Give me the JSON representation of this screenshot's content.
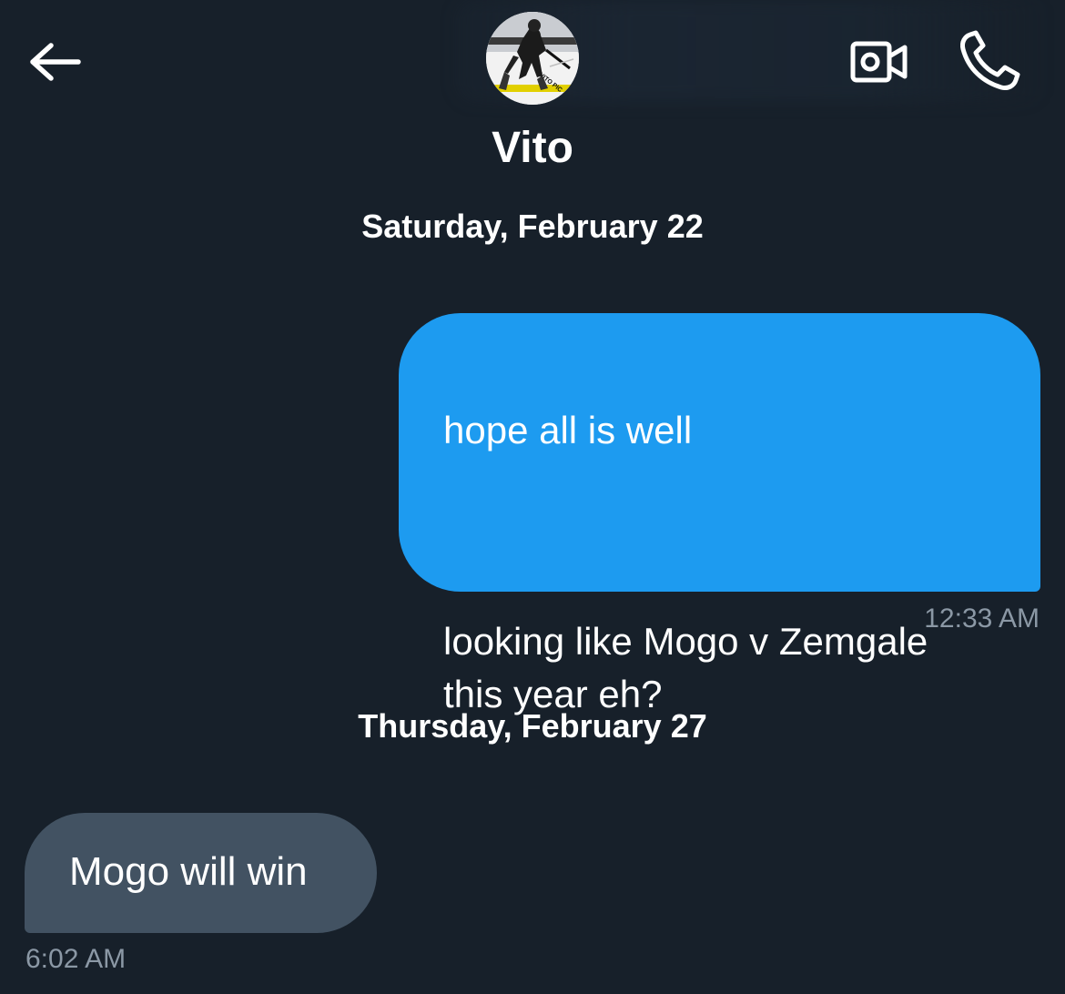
{
  "header": {
    "contact_name": "Vito",
    "avatar_caption": "VITO PIC",
    "back_icon": "arrow-left-icon",
    "video_icon": "video-camera-icon",
    "call_icon": "phone-icon"
  },
  "conversation": {
    "groups": [
      {
        "date": "Saturday, February 22",
        "messages": [
          {
            "direction": "sent",
            "paragraphs": [
              "hope all is well",
              "looking like Mogo v Zemgale\nthis year eh?"
            ],
            "time": "12:33 AM"
          }
        ]
      },
      {
        "date": "Thursday, February 27",
        "messages": [
          {
            "direction": "received",
            "text": "Mogo will win",
            "time": "6:02 AM"
          }
        ]
      }
    ]
  },
  "colors": {
    "background": "#17202a",
    "sent_bubble": "#1d9bf0",
    "received_bubble": "#425262",
    "timestamp": "#8b98a5"
  }
}
